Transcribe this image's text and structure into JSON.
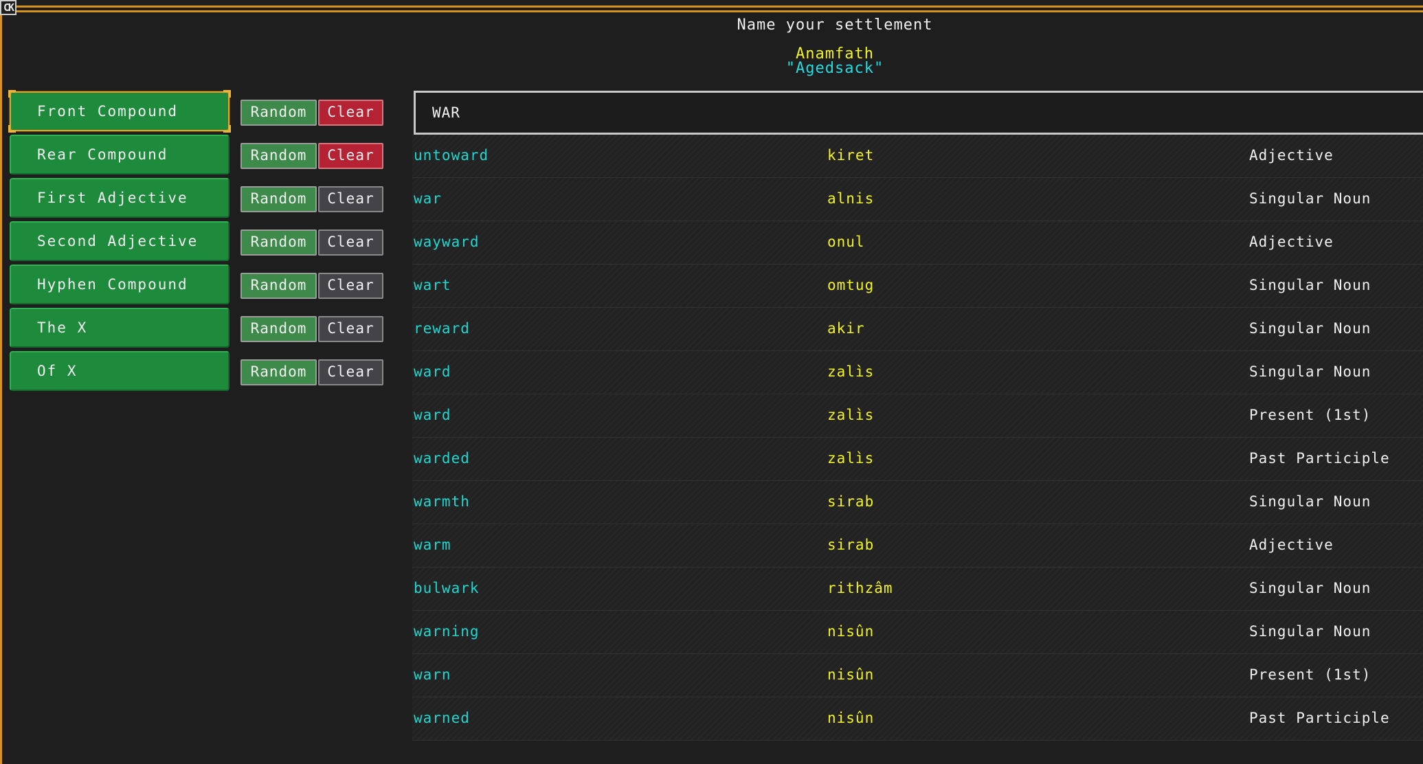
{
  "header": {
    "corner_icon": "CK",
    "title": "Name your settlement",
    "name_native": "Anamfath",
    "name_translated": "\"Agedsack\""
  },
  "categories": [
    {
      "label": "Front Compound",
      "selected": true,
      "random": "Random",
      "clear": "Clear",
      "clear_active": true
    },
    {
      "label": "Rear Compound",
      "selected": false,
      "random": "Random",
      "clear": "Clear",
      "clear_active": true
    },
    {
      "label": "First Adjective",
      "selected": false,
      "random": "Random",
      "clear": "Clear",
      "clear_active": false
    },
    {
      "label": "Second Adjective",
      "selected": false,
      "random": "Random",
      "clear": "Clear",
      "clear_active": false
    },
    {
      "label": "Hyphen Compound",
      "selected": false,
      "random": "Random",
      "clear": "Clear",
      "clear_active": false
    },
    {
      "label": "The X",
      "selected": false,
      "random": "Random",
      "clear": "Clear",
      "clear_active": false
    },
    {
      "label": "Of X",
      "selected": false,
      "random": "Random",
      "clear": "Clear",
      "clear_active": false
    }
  ],
  "search": {
    "value": "WAR"
  },
  "words": [
    {
      "english": "untoward",
      "dwarven": "kiret",
      "part": "Adjective"
    },
    {
      "english": "war",
      "dwarven": "alnis",
      "part": "Singular Noun"
    },
    {
      "english": "wayward",
      "dwarven": "onul",
      "part": "Adjective"
    },
    {
      "english": "wart",
      "dwarven": "omtug",
      "part": "Singular Noun"
    },
    {
      "english": "reward",
      "dwarven": "akir",
      "part": "Singular Noun"
    },
    {
      "english": "ward",
      "dwarven": "zalìs",
      "part": "Singular Noun"
    },
    {
      "english": "ward",
      "dwarven": "zalìs",
      "part": "Present (1st)"
    },
    {
      "english": "warded",
      "dwarven": "zalìs",
      "part": "Past Participle"
    },
    {
      "english": "warmth",
      "dwarven": "sirab",
      "part": "Singular Noun"
    },
    {
      "english": "warm",
      "dwarven": "sirab",
      "part": "Adjective"
    },
    {
      "english": "bulwark",
      "dwarven": "rithzâm",
      "part": "Singular Noun"
    },
    {
      "english": "warning",
      "dwarven": "nisûn",
      "part": "Singular Noun"
    },
    {
      "english": "warn",
      "dwarven": "nisûn",
      "part": "Present (1st)"
    },
    {
      "english": "warned",
      "dwarven": "nisûn",
      "part": "Past Participle"
    }
  ],
  "colors": {
    "frame": "#d7931f",
    "english_word": "#1ed7d0",
    "dwarven_word": "#f4f41d",
    "part_of_speech": "#f0f0f0",
    "category_button": "#1e8a3c",
    "random_button": "#3d8a4a",
    "clear_active": "#b52233",
    "clear_inactive": "#444448"
  }
}
